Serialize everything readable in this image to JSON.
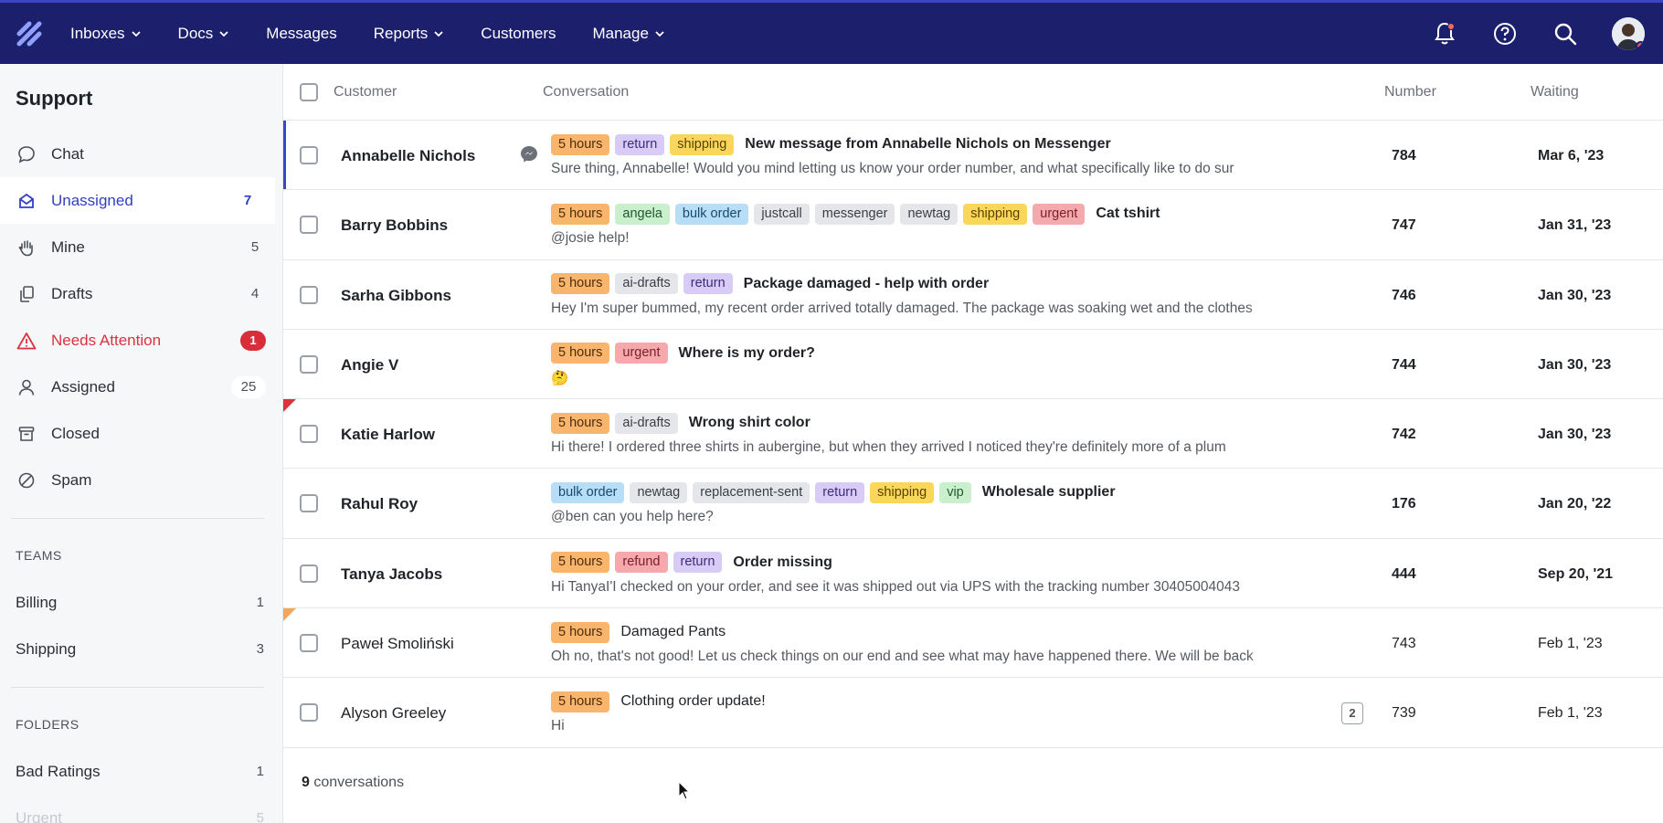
{
  "topnav": {
    "items": [
      {
        "label": "Inboxes",
        "dropdown": true
      },
      {
        "label": "Docs",
        "dropdown": true
      },
      {
        "label": "Messages",
        "dropdown": false
      },
      {
        "label": "Reports",
        "dropdown": true
      },
      {
        "label": "Customers",
        "dropdown": false
      },
      {
        "label": "Manage",
        "dropdown": true
      }
    ],
    "icons": [
      "bell-icon",
      "help-icon",
      "search-icon",
      "avatar"
    ]
  },
  "sidebar": {
    "title": "Support",
    "items": [
      {
        "label": "Chat",
        "count": "",
        "icon": "chat-bubble-icon"
      },
      {
        "label": "Unassigned",
        "count": "7",
        "icon": "inbox-icon"
      },
      {
        "label": "Mine",
        "count": "5",
        "icon": "hand-icon"
      },
      {
        "label": "Drafts",
        "count": "4",
        "icon": "drafts-icon"
      },
      {
        "label": "Needs Attention",
        "count": "1",
        "icon": "warning-icon"
      },
      {
        "label": "Assigned",
        "count": "25",
        "icon": "person-icon"
      },
      {
        "label": "Closed",
        "count": "",
        "icon": "archive-icon"
      },
      {
        "label": "Spam",
        "count": "",
        "icon": "block-icon"
      }
    ],
    "teams_label": "TEAMS",
    "teams": [
      {
        "label": "Billing",
        "count": "1"
      },
      {
        "label": "Shipping",
        "count": "3"
      }
    ],
    "folders_label": "FOLDERS",
    "folders": [
      {
        "label": "Bad Ratings",
        "count": "1"
      },
      {
        "label": "Urgent",
        "count": "5"
      }
    ]
  },
  "table": {
    "headers": {
      "customer": "Customer",
      "conversation": "Conversation",
      "number": "Number",
      "waiting": "Waiting"
    },
    "rows": [
      {
        "customer": "Annabelle Nichols",
        "tags": [
          "5 hours",
          "return",
          "shipping"
        ],
        "subject": "New message from Annabelle Nichols on Messenger",
        "preview": "Sure thing, Annabelle! Would you mind letting us know your order number, and what specifically like to do sur",
        "number": "784",
        "waiting": "Mar 6, '23"
      },
      {
        "customer": "Barry Bobbins",
        "tags": [
          "5 hours",
          "angela",
          "bulk order",
          "justcall",
          "messenger",
          "newtag",
          "shipping",
          "urgent"
        ],
        "subject": "Cat tshirt",
        "preview": "@josie help!",
        "number": "747",
        "waiting": "Jan 31, '23"
      },
      {
        "customer": "Sarha Gibbons",
        "tags": [
          "5 hours",
          "ai-drafts",
          "return"
        ],
        "subject": "Package damaged - help with order",
        "preview": "Hey I'm super bummed, my recent order arrived totally damaged. The package was soaking wet and the clothes",
        "number": "746",
        "waiting": "Jan 30, '23"
      },
      {
        "customer": "Angie V",
        "tags": [
          "5 hours",
          "urgent"
        ],
        "subject": "Where is my order?",
        "preview": "🤔",
        "number": "744",
        "waiting": "Jan 30, '23"
      },
      {
        "customer": "Katie Harlow",
        "tags": [
          "5 hours",
          "ai-drafts"
        ],
        "subject": "Wrong shirt color",
        "preview": "Hi there! I ordered three shirts in aubergine, but when they arrived I noticed they're definitely more of a plum",
        "number": "742",
        "waiting": "Jan 30, '23"
      },
      {
        "customer": "Rahul Roy",
        "tags": [
          "bulk order",
          "newtag",
          "replacement-sent",
          "return",
          "shipping",
          "vip"
        ],
        "subject": "Wholesale supplier",
        "preview": "@ben can you help here?",
        "number": "176",
        "waiting": "Jan 20, '22"
      },
      {
        "customer": "Tanya Jacobs",
        "tags": [
          "5 hours",
          "refund",
          "return"
        ],
        "subject": "Order missing",
        "preview": "Hi TanyaI'I checked on your order, and see it was shipped out via UPS with the tracking number 30405004043",
        "number": "444",
        "waiting": "Sep 20, '21"
      },
      {
        "customer": "Paweł Smoliński",
        "tags": [
          "5 hours"
        ],
        "subject": "Damaged Pants",
        "preview": "Oh no, that's not good! Let us check things on our end and see what may have happened there. We will be back",
        "number": "743",
        "waiting": "Feb 1, '23"
      },
      {
        "customer": "Alyson Greeley",
        "tags": [
          "5 hours"
        ],
        "subject": "Clothing order update!",
        "preview": "Hi",
        "number": "739",
        "waiting": "Feb 1, '23",
        "thread_count": "2"
      }
    ],
    "footer": {
      "count": "9",
      "label": "conversations"
    }
  },
  "colors": {
    "nav_bg": "#1c1f6b",
    "accent": "#3140c3",
    "alert": "#d92d3a",
    "tag_5hours": "#f9b56b",
    "tag_return": "#d8ccf7",
    "tag_shipping": "#fad75a",
    "tag_gray": "#e4e6e9",
    "tag_green": "#c9efcd",
    "tag_blue": "#b8def7",
    "tag_red": "#f5a9ad"
  }
}
